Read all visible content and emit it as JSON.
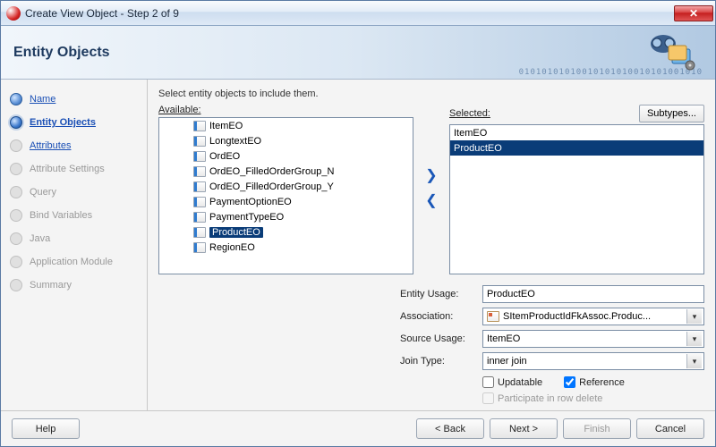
{
  "window": {
    "title": "Create View Object - Step 2 of 9"
  },
  "header": {
    "title": "Entity Objects",
    "digits": "01010101010010101010010101001010"
  },
  "steps": [
    {
      "label": "Name",
      "state": "done"
    },
    {
      "label": "Entity Objects",
      "state": "current"
    },
    {
      "label": "Attributes",
      "state": "link"
    },
    {
      "label": "Attribute Settings",
      "state": "future"
    },
    {
      "label": "Query",
      "state": "future"
    },
    {
      "label": "Bind Variables",
      "state": "future"
    },
    {
      "label": "Java",
      "state": "future"
    },
    {
      "label": "Application Module",
      "state": "future"
    },
    {
      "label": "Summary",
      "state": "future"
    }
  ],
  "instruction": "Select entity objects to include them.",
  "labels": {
    "available": "Available:",
    "selected": "Selected:",
    "subtypes": "Subtypes..."
  },
  "available": {
    "items": [
      "ItemEO",
      "LongtextEO",
      "OrdEO",
      "OrdEO_FilledOrderGroup_N",
      "OrdEO_FilledOrderGroup_Y",
      "PaymentOptionEO",
      "PaymentTypeEO",
      "ProductEO",
      "RegionEO"
    ],
    "selected": "ProductEO"
  },
  "selected": {
    "items": [
      "ItemEO",
      "ProductEO"
    ],
    "active": "ProductEO"
  },
  "form": {
    "entity_usage": {
      "label": "Entity Usage:",
      "value": "ProductEO"
    },
    "association": {
      "label": "Association:",
      "value": "SItemProductIdFkAssoc.Produc..."
    },
    "source_usage": {
      "label": "Source Usage:",
      "value": "ItemEO"
    },
    "join_type": {
      "label": "Join Type:",
      "value": "inner join"
    },
    "updatable": {
      "label": "Updatable",
      "checked": false
    },
    "reference": {
      "label": "Reference",
      "checked": true
    },
    "participate": {
      "label": "Participate in row delete",
      "checked": false
    }
  },
  "buttons": {
    "help": "Help",
    "back": "< Back",
    "next": "Next >",
    "finish": "Finish",
    "cancel": "Cancel"
  }
}
